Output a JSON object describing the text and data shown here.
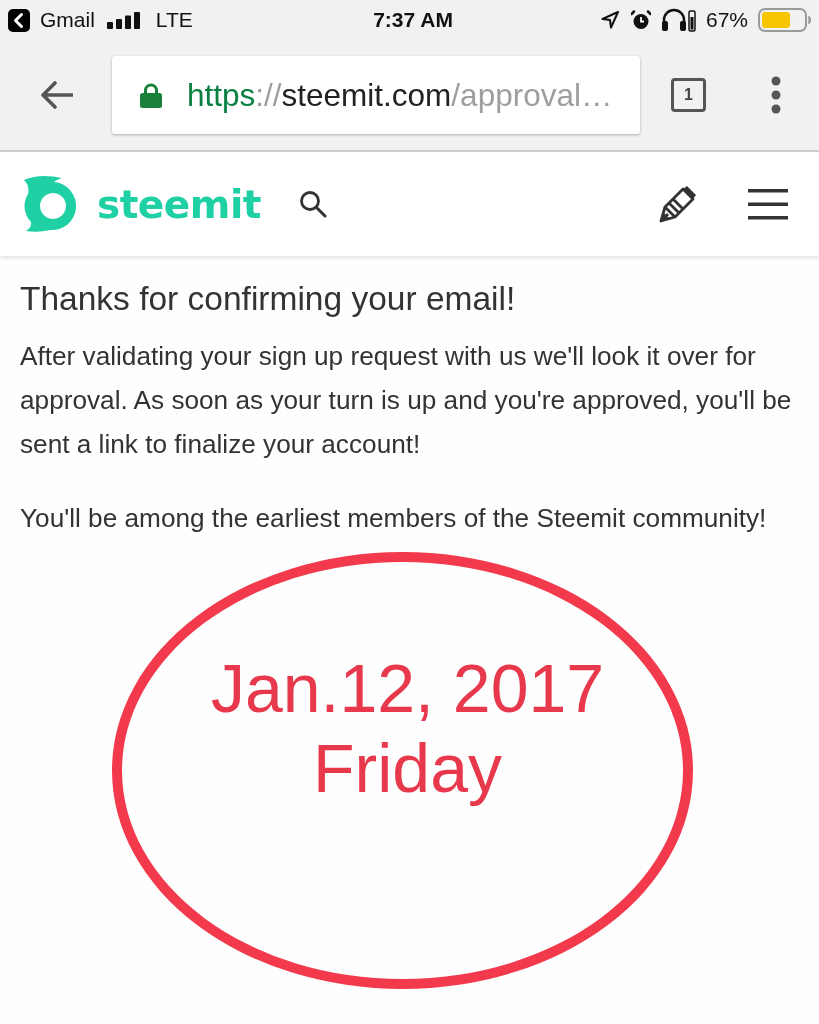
{
  "status_bar": {
    "back_to_app": "Gmail",
    "network": "LTE",
    "time": "7:37 AM",
    "battery": "67%"
  },
  "browser_toolbar": {
    "secure": true,
    "url": [
      {
        "kind": "scheme",
        "text": "https"
      },
      {
        "kind": "separator",
        "text": "://"
      },
      {
        "kind": "host",
        "text": "steemit.com"
      },
      {
        "kind": "path",
        "text": "/approval…"
      }
    ],
    "tab_count": "1"
  },
  "site_header": {
    "logo": "steemit"
  },
  "content": {
    "title": "Thanks for confirming your email!",
    "paragraphs": [
      "After validating your sign up request with us we'll look it over for approval. As soon as your turn is up and you're approved, you'll be sent a link to finalize your account!",
      "You'll be among the earliest members of the Steemit community!"
    ]
  },
  "annotation": {
    "lines": [
      "Jan.12, 2017",
      "Friday"
    ]
  }
}
